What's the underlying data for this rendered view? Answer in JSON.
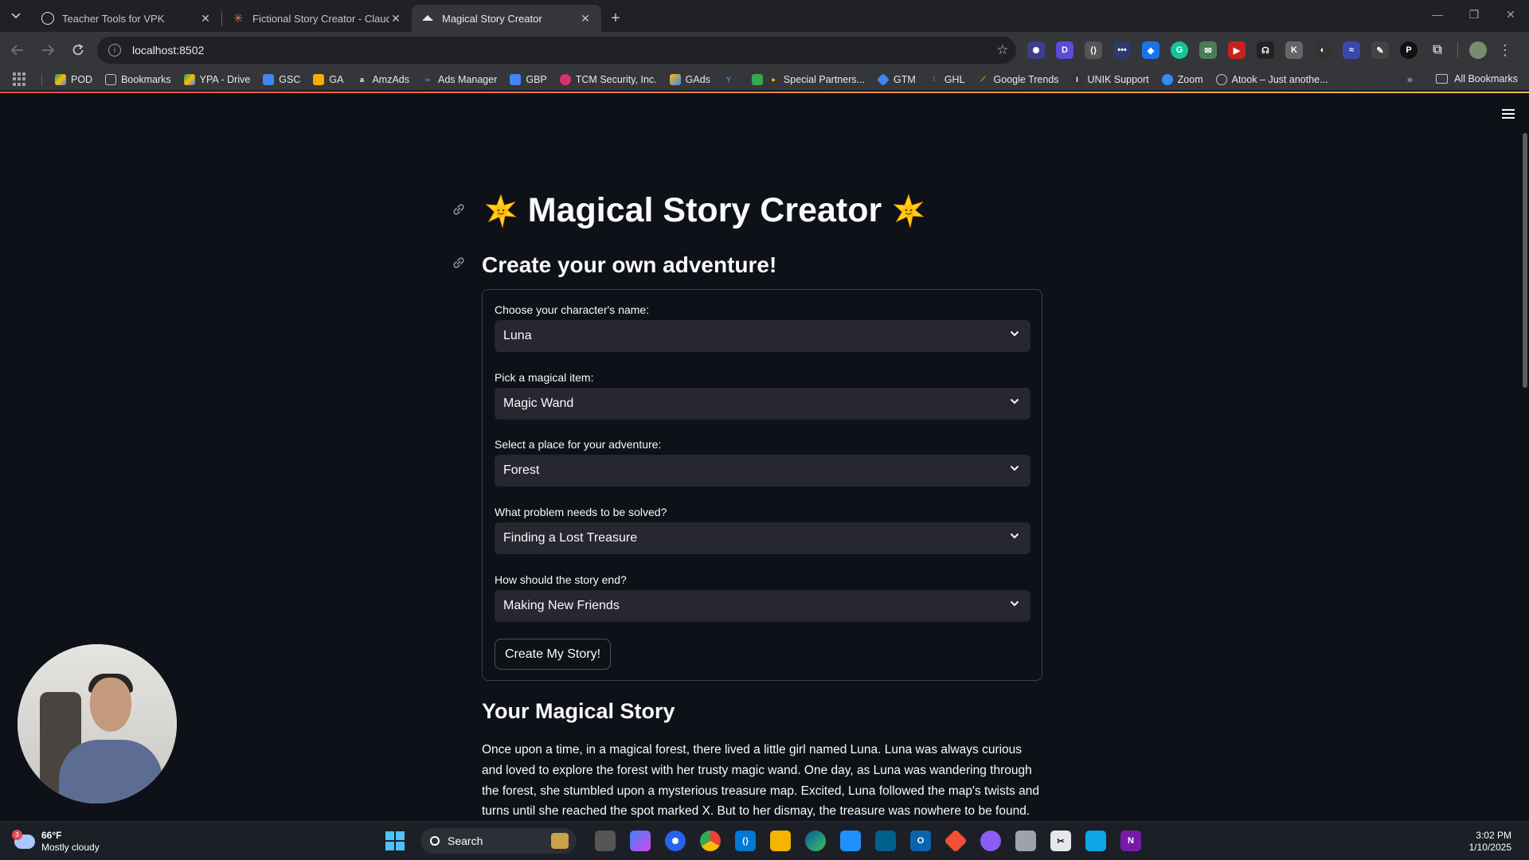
{
  "browser": {
    "tabs": [
      {
        "title": "Teacher Tools for VPK",
        "favicon": "openai-icon",
        "active": false
      },
      {
        "title": "Fictional Story Creator - Claude",
        "favicon": "claude-icon",
        "active": false
      },
      {
        "title": "Magical Story Creator",
        "favicon": "streamlit-icon",
        "active": true
      }
    ],
    "url": "localhost:8502",
    "bookmarks": [
      "POD",
      "Bookmarks",
      "YPA - Drive",
      "GSC",
      "GA",
      "AmzAds",
      "Ads Manager",
      "GBP",
      "TCM Security, Inc.",
      "GAds",
      "",
      "Special Partners...",
      "GTM",
      "GHL",
      "Google Trends",
      "UNIK Support",
      "Zoom",
      "Atook – Just anothe..."
    ],
    "all_bookmarks": "All Bookmarks"
  },
  "app": {
    "title": "Magical Story Creator",
    "subtitle": "Create your own adventure!",
    "form": {
      "fields": [
        {
          "label": "Choose your character's name:",
          "value": "Luna"
        },
        {
          "label": "Pick a magical item:",
          "value": "Magic Wand"
        },
        {
          "label": "Select a place for your adventure:",
          "value": "Forest"
        },
        {
          "label": "What problem needs to be solved?",
          "value": "Finding a Lost Treasure"
        },
        {
          "label": "How should the story end?",
          "value": "Making New Friends"
        }
      ],
      "submit_label": "Create My Story!"
    },
    "story": {
      "heading": "Your Magical Story",
      "text": "Once upon a time, in a magical forest, there lived a little girl named Luna. Luna was always curious and loved to explore the forest with her trusty magic wand. One day, as Luna was wandering through the forest, she stumbled upon a mysterious treasure map. Excited, Luna followed the map's twists and turns until she reached the spot marked X. But to her dismay, the treasure was nowhere to be found."
    }
  },
  "taskbar": {
    "weather_temp": "66°F",
    "weather_desc": "Mostly cloudy",
    "weather_badge": "3",
    "search_label": "Search",
    "time": "3:02 PM",
    "date": "1/10/2025"
  },
  "colors": {
    "page_bg": "#0e1117",
    "select_bg": "#262730",
    "accent": "#ff4b4b",
    "text": "#fafafa"
  }
}
